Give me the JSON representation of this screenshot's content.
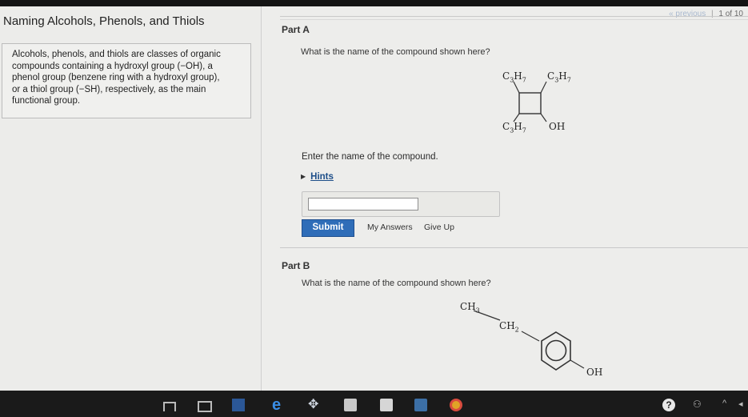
{
  "window": {
    "title": "Naming Alcohols, Phenols, and Thiols"
  },
  "pager": {
    "previous": "« previous",
    "separator": "|",
    "count": "1 of 10"
  },
  "intro": {
    "lines": [
      "Alcohols, phenols, and thiols are classes of organic",
      "compounds containing a hydroxyl group (−OH), a",
      "phenol group (benzene ring with a hydroxyl group),",
      "or a thiol group (−SH), respectively, as the main",
      "functional group."
    ]
  },
  "partA": {
    "title": "Part A",
    "question": "What is the name of the compound shown here?",
    "molecule": {
      "top_left": "C3H7",
      "top_right": "C3H7",
      "bottom_left": "C3H7",
      "bottom_right": "OH"
    },
    "prompt": "Enter the name of the compound.",
    "hints_label": "Hints",
    "answer_value": "",
    "submit_label": "Submit",
    "my_answers_label": "My Answers",
    "give_up_label": "Give Up"
  },
  "partB": {
    "title": "Part B",
    "question": "What is the name of the compound shown here?",
    "molecule": {
      "ch3": "CH3",
      "ch2": "CH2",
      "oh": "OH"
    }
  },
  "taskbar": {
    "icons": [
      "windows-start-icon",
      "task-view-icon",
      "word-icon",
      "edge-icon",
      "dropbox-icon",
      "store-icon",
      "mail-icon",
      "photos-icon",
      "chrome-icon",
      "help-icon",
      "people-icon",
      "tray-arrow-icon",
      "volume-icon"
    ]
  },
  "colors": {
    "submit": "#2f6db8",
    "hint_link": "#1d4e89",
    "taskbar": "#1a1a1a"
  }
}
